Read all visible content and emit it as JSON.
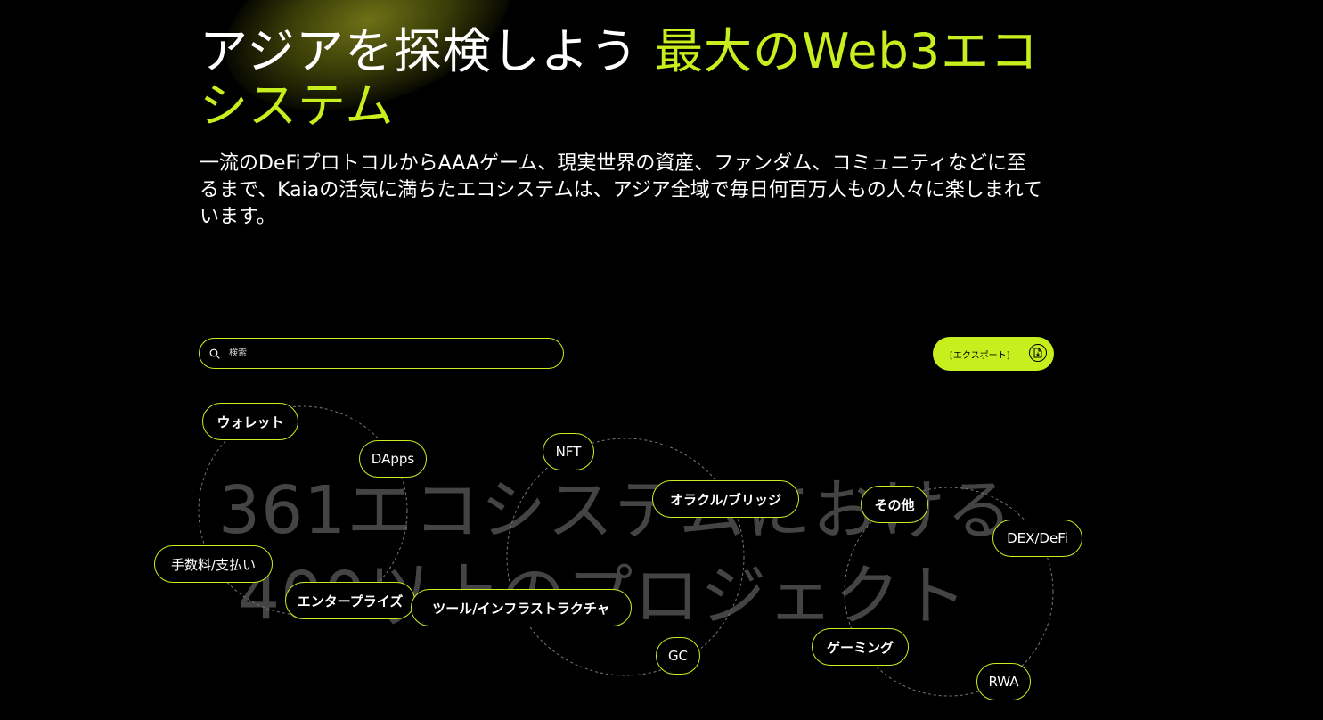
{
  "hero": {
    "title_white": "アジアを探検しよう",
    "title_accent": "最大のWeb3エコシステム",
    "subtitle": "一流のDeFiプロトコルからAAAゲーム、現実世界の資産、ファンダム、コミュニティなどに至るまで、Kaiaの活気に満ちたエコシステムは、アジア全域で毎日何百万人もの人々に楽しまれています。"
  },
  "search": {
    "placeholder": "検索"
  },
  "export": {
    "label": "[エクスポート]"
  },
  "background_text": {
    "line1": "361エコシステムにおける",
    "line2": "400以上のプロジェクト"
  },
  "categories": [
    {
      "label": "ウォレット"
    },
    {
      "label": "DApps"
    },
    {
      "label": "NFT"
    },
    {
      "label": "オラクル/ブリッジ"
    },
    {
      "label": "その他"
    },
    {
      "label": "DEX/DeFi"
    },
    {
      "label": "手数料/支払い"
    },
    {
      "label": "エンタープライズ"
    },
    {
      "label": "ツール/インフラストラクチャ"
    },
    {
      "label": "GC"
    },
    {
      "label": "ゲーミング"
    },
    {
      "label": "RWA"
    }
  ],
  "colors": {
    "accent": "#c7ef1e",
    "background": "#000000",
    "background_text": "#444444"
  },
  "icons": {
    "search": "search-icon",
    "export": "export-file-icon"
  }
}
